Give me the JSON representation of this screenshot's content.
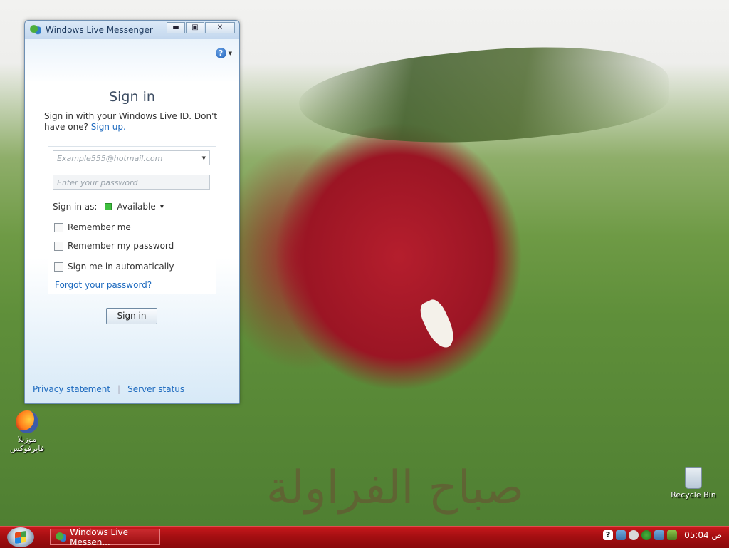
{
  "window": {
    "title": "Windows Live Messenger",
    "controls": {
      "minimize": "▬",
      "maximize": "▣",
      "close": "✕"
    }
  },
  "signin": {
    "heading": "Sign in",
    "description": "Sign in with your Windows Live ID. Don't have one?",
    "signup_link": "Sign up.",
    "email_placeholder": "Example555@hotmail.com",
    "password_placeholder": "Enter your password",
    "status_label": "Sign in as:",
    "status_value": "Available",
    "status_color": "#3fbf3f",
    "remember_me": "Remember me",
    "remember_password": "Remember my password",
    "auto_signin": "Sign me in automatically",
    "forgot_link": "Forgot your password?",
    "submit_label": "Sign in",
    "privacy_link": "Privacy statement",
    "server_status_link": "Server status"
  },
  "desktop": {
    "recycle_bin": "Recycle Bin",
    "firefox": "موزيلا فايرفوكس",
    "caption": "صباح الفراولة"
  },
  "taskbar": {
    "task_label": "Windows Live Messen...",
    "clock": "05:04 ص",
    "help_icon": "?"
  },
  "colors": {
    "taskbar": "#a50f12",
    "link": "#1f6bbf"
  }
}
